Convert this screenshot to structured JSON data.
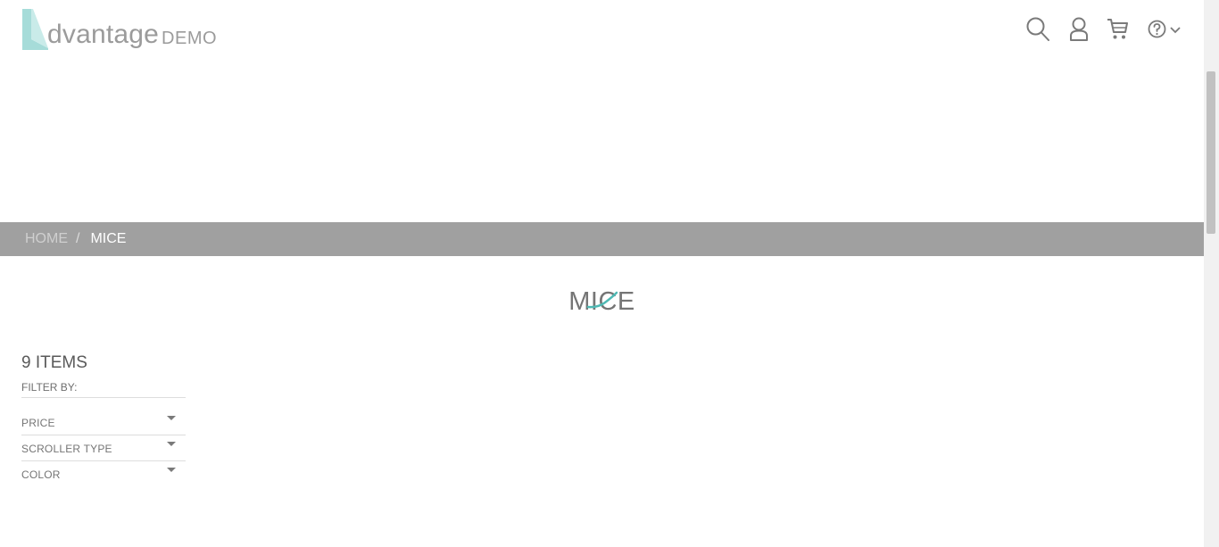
{
  "header": {
    "logo_word": "dvantage",
    "logo_suffix": "DEMO",
    "icons": [
      "search-icon",
      "user-icon",
      "cart-icon",
      "help-icon",
      "chevron-down-icon"
    ]
  },
  "breadcrumb": {
    "home_label": "HOME",
    "separator": "/",
    "current_label": "MICE"
  },
  "main": {
    "title": "MICE"
  },
  "filters": {
    "items_count": "9 ITEMS",
    "filter_by_label": "FILTER BY:",
    "options": [
      {
        "label": "PRICE"
      },
      {
        "label": "SCROLLER TYPE"
      },
      {
        "label": "COLOR"
      }
    ]
  },
  "colors": {
    "brand_teal": "#4fb9b4",
    "logo_mark": "#a6dcd9",
    "breadcrumb_bg": "#a0a0a0",
    "text_gray": "#757575"
  }
}
